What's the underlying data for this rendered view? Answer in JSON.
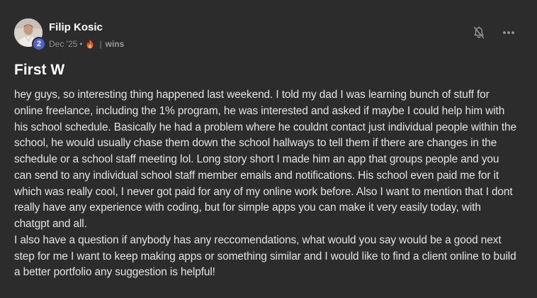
{
  "post": {
    "author": "Filip Kosic",
    "level": "2",
    "date": "Dec '25",
    "dot": "•",
    "divider": "|",
    "category": "wins",
    "title": "First W",
    "body": "hey guys, so interesting thing happened last weekend. I told my dad I was learning bunch of stuff for online freelance, including the 1% program, he was interested and asked if maybe I could help him with his school schedule. Basically he had a problem where he couldnt contact just individual people within the school, he would usually chase them down the school hallways to tell them if there are changes in the schedule or a school staff meeting lol. Long story short I made him an app that groups people and you can send to any individual school staff member emails and notifications. His school even paid me for it which was really cool, I never got paid for any of my online work before. Also I want to mention that I dont really have any experience with coding, but for simple apps you can make it very easily today, with chatgpt and all.\nI also have a question if anybody has any reccomendations, what would you say would be a good next step for me I want to keep making apps or something similar and I would like to find a client online to build a better portfolio any suggestion is helpful!"
  },
  "icons": {
    "fire": "fire-icon",
    "bell": "bell-off-icon",
    "more": "more-horizontal-icon"
  },
  "colors": {
    "background": "#2c2c2c",
    "level_badge": "#4e63d0",
    "muted_text": "#8f8f8f"
  }
}
